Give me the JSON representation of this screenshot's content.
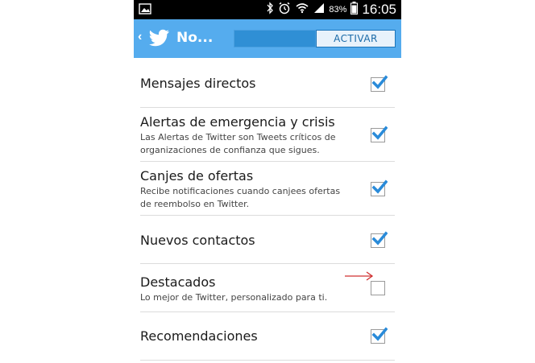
{
  "status_bar": {
    "battery": "83%",
    "time": "16:05",
    "icons": [
      "image-icon",
      "bluetooth-icon",
      "alarm-icon",
      "wifi-icon",
      "signal-icon",
      "battery-icon"
    ]
  },
  "action_bar": {
    "title": "No...",
    "activate_label": "ACTIVAR",
    "icons": [
      "back-chevron-icon",
      "twitter-bird-icon"
    ]
  },
  "settings": [
    {
      "label": "Mensajes directos",
      "desc": "",
      "checked": true
    },
    {
      "label": "Alertas de emergencia y crisis",
      "desc": "Las Alertas de Twitter son Tweets críticos de organizaciones de confianza que sigues.",
      "checked": true
    },
    {
      "label": "Canjes de ofertas",
      "desc": "Recibe notificaciones cuando canjees ofertas de reembolso en Twitter.",
      "checked": true
    },
    {
      "label": "Nuevos contactos",
      "desc": "",
      "checked": true
    },
    {
      "label": "Destacados",
      "desc": "Lo mejor de Twitter, personalizado para ti.",
      "checked": false
    },
    {
      "label": "Recomendaciones",
      "desc": "",
      "checked": true
    }
  ],
  "colors": {
    "action_bar": "#55acee",
    "check": "#2a8bd9",
    "annotation_arrow": "#d03030"
  }
}
